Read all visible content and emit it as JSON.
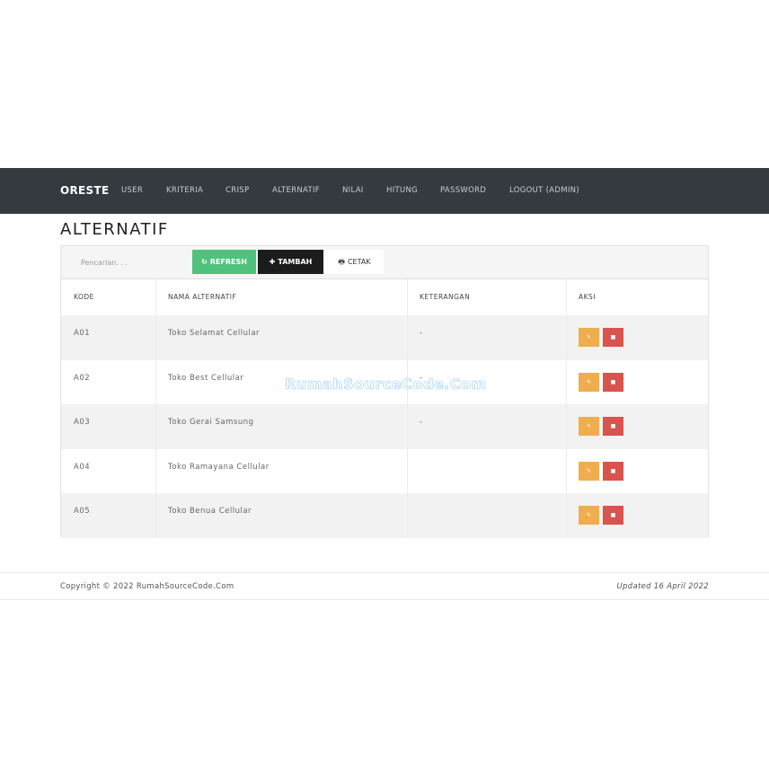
{
  "navbar": {
    "brand": "ORESTE",
    "items": [
      {
        "label": "USER"
      },
      {
        "label": "KRITERIA"
      },
      {
        "label": "CRISP"
      },
      {
        "label": "ALTERNATIF"
      },
      {
        "label": "NILAI"
      },
      {
        "label": "HITUNG"
      },
      {
        "label": "PASSWORD"
      },
      {
        "label": "LOGOUT (ADMIN)"
      }
    ]
  },
  "page": {
    "title": "ALTERNATIF"
  },
  "toolbar": {
    "search_placeholder": "Pencarian. . .",
    "refresh_label": "REFRESH",
    "tambah_label": "TAMBAH",
    "cetak_label": "CETAK"
  },
  "table": {
    "headers": {
      "kode": "KODE",
      "nama": "NAMA ALTERNATIF",
      "keterangan": "KETERANGAN",
      "aksi": "AKSI"
    },
    "rows": [
      {
        "kode": "A01",
        "nama": "Toko Selamat Cellular",
        "keterangan": "-"
      },
      {
        "kode": "A02",
        "nama": "Toko Best Cellular",
        "keterangan": "-"
      },
      {
        "kode": "A03",
        "nama": "Toko Gerai Samsung",
        "keterangan": "-"
      },
      {
        "kode": "A04",
        "nama": "Toko Ramayana Cellular",
        "keterangan": ""
      },
      {
        "kode": "A05",
        "nama": "Toko Benua Cellular",
        "keterangan": ""
      }
    ]
  },
  "watermark": "RumahSourceCode.Com",
  "footer": {
    "copyright": "Copyright © 2022 RumahSourceCode.Com",
    "updated": "Updated 16 April 2022"
  },
  "colors": {
    "navbar_bg": "#343a40",
    "refresh": "#4fc27d",
    "tambah": "#1c1c1c",
    "edit": "#f0ad4e",
    "delete": "#d9534f"
  },
  "icons": {
    "refresh": "refresh-icon",
    "tambah": "plus-icon",
    "cetak": "print-icon",
    "edit": "edit-icon",
    "delete": "trash-icon"
  }
}
